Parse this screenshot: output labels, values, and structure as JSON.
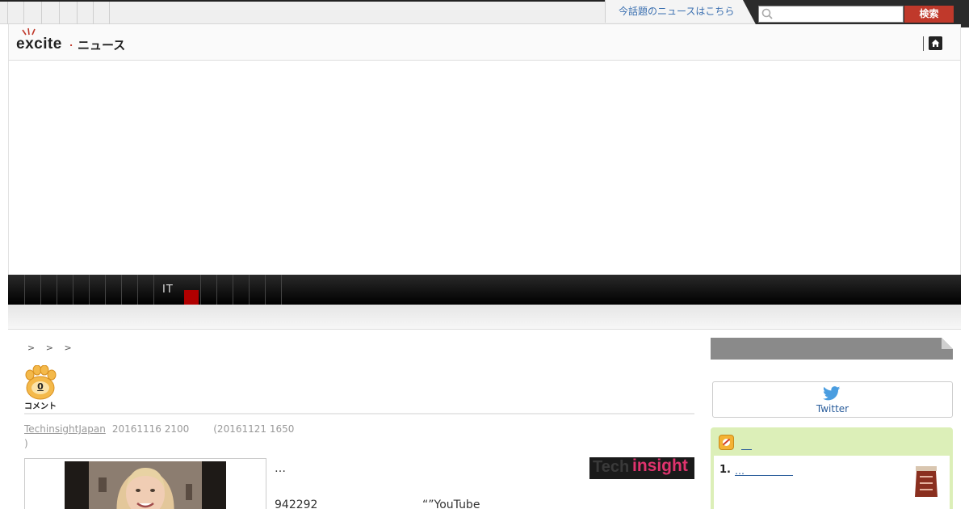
{
  "header": {
    "hot_news_link": "今話題のニュースはこちら",
    "search_button": "検索",
    "search_placeholder": ""
  },
  "logo": {
    "brand": "excite",
    "dot": ".",
    "service": "ニュース"
  },
  "nav": {
    "active_category": "IT"
  },
  "breadcrumb": [
    ">",
    ">",
    ">"
  ],
  "article": {
    "comment_count": "0",
    "comment_label": "コメント",
    "source": "TechinsightJapan",
    "date": "20161116 2100",
    "updated": "(20161121 1650",
    "updated_close": ")",
    "text_1": "…",
    "text_2": "942292",
    "text_3": "“”YouTube",
    "source_logo_a": "Tech",
    "source_logo_b": "insight"
  },
  "sidebar": {
    "twitter_label": "Twitter",
    "ranking_title": "＿",
    "ranking_items": [
      {
        "rank": "1.",
        "title": "…＿＿＿＿＿"
      }
    ]
  },
  "colors": {
    "accent_red": "#c0392b",
    "link_blue": "#2a5d9b",
    "ranking_bg": "#dcefb8",
    "nav_black": "#000000"
  }
}
